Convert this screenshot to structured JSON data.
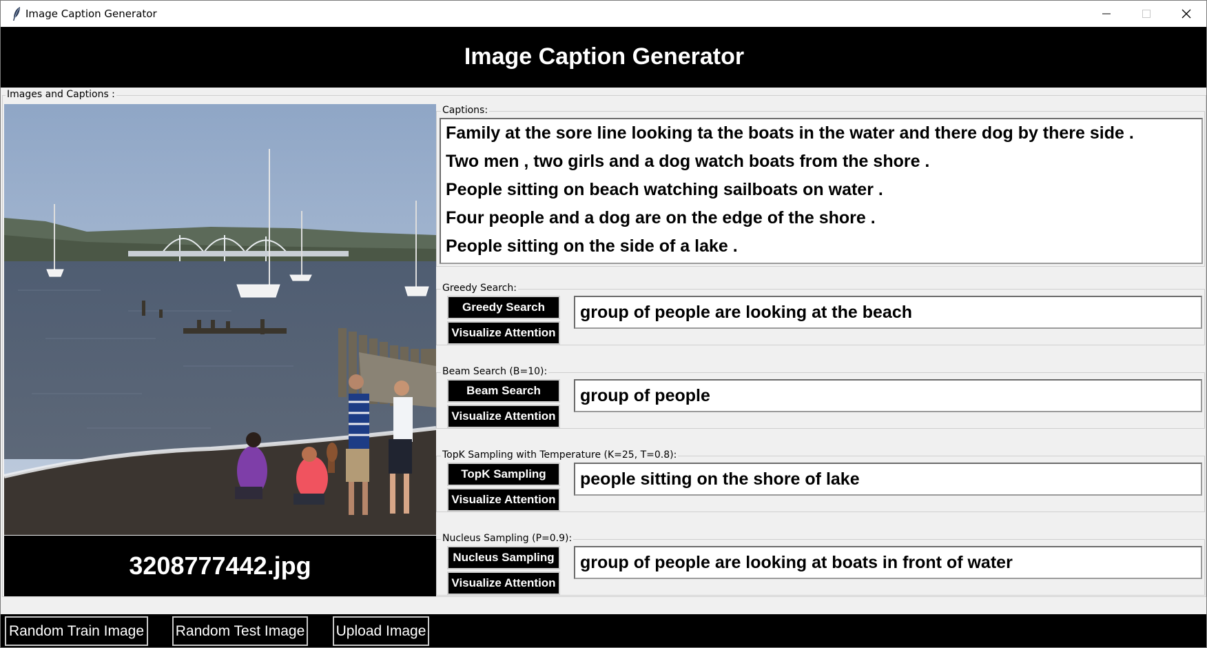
{
  "window": {
    "title": "Image Caption Generator"
  },
  "header": {
    "title": "Image Caption Generator"
  },
  "images_panel": {
    "label": "Images and Captions :",
    "filename": "3208777442.jpg"
  },
  "captions": {
    "label": "Captions:",
    "items": [
      "Family at the sore line looking ta the boats in the water and there dog by there side .",
      "Two men , two girls and a dog watch boats from the shore .",
      "People sitting on beach watching sailboats on water .",
      "Four people and a dog are on the edge of the shore .",
      "People sitting on the side of a lake ."
    ]
  },
  "greedy": {
    "label": "Greedy Search:",
    "button": "Greedy Search",
    "visualize": "Visualize Attention",
    "result": "group of people are looking at the beach"
  },
  "beam": {
    "label": "Beam Search (B=10):",
    "button": "Beam Search",
    "visualize": "Visualize Attention",
    "result": "group of people"
  },
  "topk": {
    "label": "TopK Sampling with Temperature (K=25, T=0.8):",
    "button": "TopK Sampling",
    "visualize": "Visualize Attention",
    "result": "people sitting on the shore of lake"
  },
  "nucleus": {
    "label": "Nucleus Sampling (P=0.9):",
    "button": "Nucleus Sampling",
    "visualize": "Visualize Attention",
    "result": "group of people are looking at boats in front of water"
  },
  "footer": {
    "random_train": "Random Train Image",
    "random_test": "Random Test Image",
    "upload": "Upload Image"
  }
}
